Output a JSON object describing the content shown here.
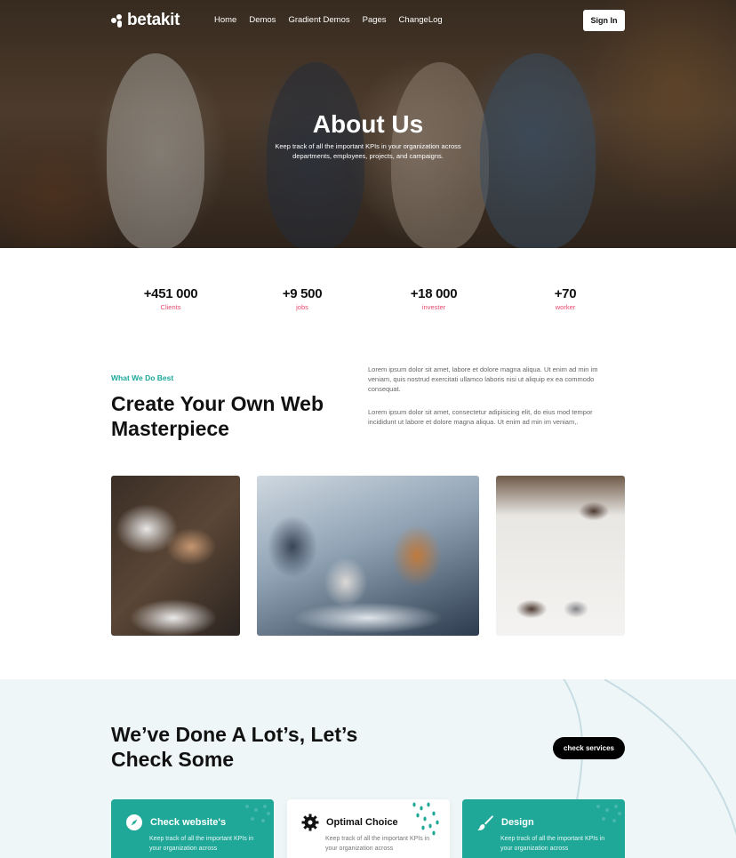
{
  "nav": {
    "brand": "betakit",
    "links": [
      "Home",
      "Demos",
      "Gradient Demos",
      "Pages",
      "ChangeLog"
    ],
    "signin": "Sign In"
  },
  "hero": {
    "title": "About Us",
    "subtitle": "Keep track of all the important KPIs in your organization across departments, employees, projects, and campaigns."
  },
  "stats": [
    {
      "value": "+451 000",
      "label": "Clients"
    },
    {
      "value": "+9 500",
      "label": "jobs"
    },
    {
      "value": "+18 000",
      "label": "invester"
    },
    {
      "value": "+70",
      "label": "worker"
    }
  ],
  "about": {
    "eyebrow": "What We Do Best",
    "headline": "Create Your Own Web Masterpiece",
    "paragraphs": [
      "Lorem ipsum dolor sit amet, labore et dolore magna aliqua. Ut enim ad min im veniam, quis nostrud exercitati ullamco laboris nisi ut aliquip ex ea commodo consequat.",
      "Lorem ipsum dolor sit amet, consectetur adipisicing elit, do eius mod tempor incididunt ut labore et dolore magna aliqua. Ut enim ad min im veniam,."
    ]
  },
  "services": {
    "title": "We’ve Done A Lot’s, Let’s Check Some",
    "button": "check services",
    "cards": [
      {
        "title": "Check website's",
        "text": "Keep track of all the important KPIs in your organization across",
        "icon": "compass-icon",
        "style": "teal"
      },
      {
        "title": "Optimal Choice",
        "text": "Keep track of all the important KPIs in your organization across",
        "icon": "gear-icon",
        "style": "white"
      },
      {
        "title": "Design",
        "text": "Keep track of all the important KPIs in your organization across",
        "icon": "brush-icon",
        "style": "teal"
      }
    ]
  },
  "colors": {
    "accent_teal": "#1fa898",
    "accent_pink": "#e84a6f",
    "services_bg": "#eef6f7"
  }
}
